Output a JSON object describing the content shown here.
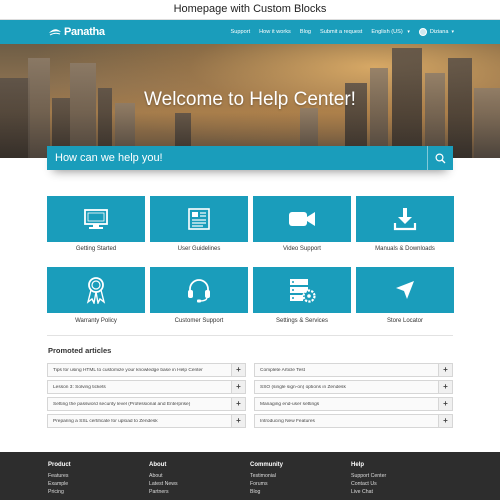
{
  "caption": "Homepage with Custom Blocks",
  "brand": {
    "name": "Panatha",
    "accent": "#1a9dbb"
  },
  "nav": {
    "links": [
      "Support",
      "How it works",
      "Blog",
      "Submit a request",
      "English (US)"
    ],
    "user_name": "Diziana"
  },
  "hero": {
    "title": "Welcome to Help Center!"
  },
  "search": {
    "placeholder": "How can we help you!",
    "icon": "search-icon"
  },
  "categories": [
    {
      "label": "Getting Started",
      "icon": "monitor-icon"
    },
    {
      "label": "User Guidelines",
      "icon": "document-icon"
    },
    {
      "label": "Video Support",
      "icon": "video-camera-icon"
    },
    {
      "label": "Manuals & Downloads",
      "icon": "download-icon"
    },
    {
      "label": "Warranty Policy",
      "icon": "award-ribbon-icon"
    },
    {
      "label": "Customer Support",
      "icon": "headset-icon"
    },
    {
      "label": "Settings & Services",
      "icon": "server-settings-icon"
    },
    {
      "label": "Store Locator",
      "icon": "location-arrow-icon"
    }
  ],
  "promoted": {
    "title": "Promoted articles",
    "left": [
      "Tips for using HTML to customize your knowledge base in Help Center",
      "Lesson 3: Solving tickets",
      "Setting the password security level (Professional and Enterprise)",
      "Preparing a SSL certificate for upload to Zendesk"
    ],
    "right": [
      "Complete Article Test",
      "SSO (single sign-on) options in Zendesk",
      "Managing end-user settings",
      "Introducing New Features"
    ],
    "expand_symbol": "+"
  },
  "footer": {
    "columns": [
      {
        "title": "Product",
        "links": [
          "Features",
          "Example",
          "Pricing"
        ]
      },
      {
        "title": "About",
        "links": [
          "About",
          "Latest News",
          "Partners"
        ]
      },
      {
        "title": "Community",
        "links": [
          "Testimonial",
          "Forums",
          "Blog"
        ]
      },
      {
        "title": "Help",
        "links": [
          "Support Center",
          "Contact Us",
          "Live Chat"
        ]
      }
    ]
  }
}
